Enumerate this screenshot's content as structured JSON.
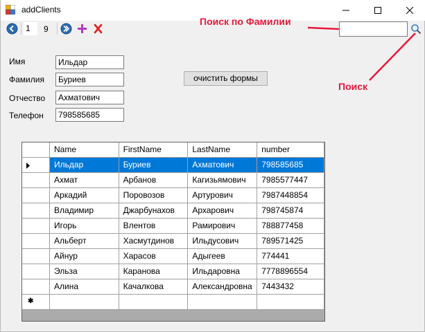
{
  "window": {
    "title": "addClients"
  },
  "toolbar": {
    "position": "1",
    "count": "9"
  },
  "search": {
    "value": "",
    "placeholder": ""
  },
  "form": {
    "fields": [
      {
        "label": "Имя",
        "value": "Ильдар"
      },
      {
        "label": "Фамилия",
        "value": "Буриев"
      },
      {
        "label": "Отчество",
        "value": "Ахматович"
      },
      {
        "label": "Телефон",
        "value": "798585685"
      }
    ],
    "clear_button": "очистить формы"
  },
  "annotations": {
    "surname_search": "Поиск по Фамилии",
    "search": "Поиск",
    "color": "#e8183b"
  },
  "grid": {
    "columns": [
      "Name",
      "FirstName",
      "LastName",
      "number"
    ],
    "rows": [
      [
        "Ильдар",
        "Буриев",
        "Ахматович",
        "798585685"
      ],
      [
        "Ахмат",
        "Арбанов",
        "Кагизьямович",
        "7985577447"
      ],
      [
        "Аркадий",
        "Поровозов",
        "Артурович",
        "7987448854"
      ],
      [
        "Владимир",
        "Джарбунахов",
        "Архарович",
        "798745874"
      ],
      [
        "Игорь",
        "Влентов",
        "Рамирович",
        "788877458"
      ],
      [
        "Альберт",
        "Хасмутдинов",
        "Ильдусович",
        "789571425"
      ],
      [
        "Айнур",
        "Харасов",
        "Адыгеев",
        "774441"
      ],
      [
        "Эльза",
        "Каранова",
        "Ильдаровна",
        "7778896554"
      ],
      [
        "Алина",
        "Качалкова",
        "Александровна",
        "7443432"
      ]
    ],
    "selected_color": "#0078d7"
  }
}
